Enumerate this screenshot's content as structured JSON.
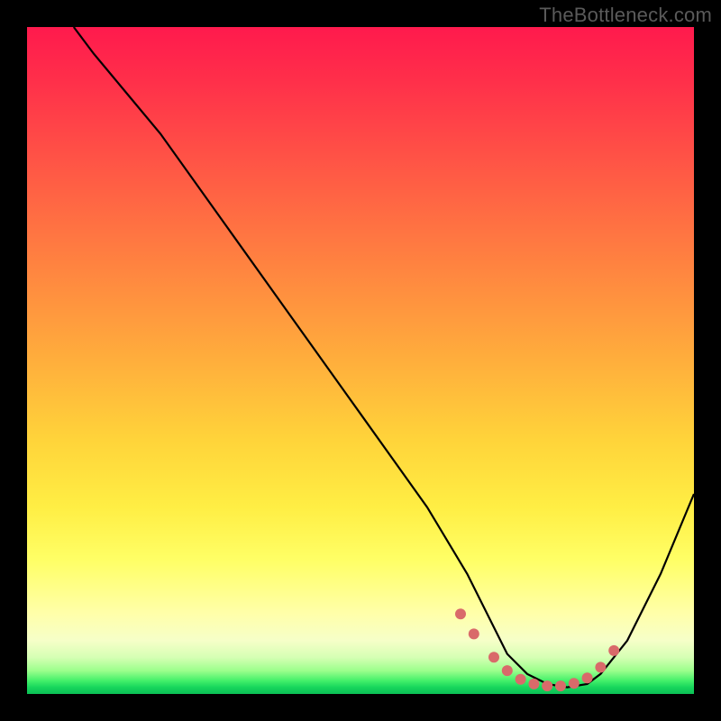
{
  "watermark": "TheBottleneck.com",
  "chart_data": {
    "type": "line",
    "title": "",
    "xlabel": "",
    "ylabel": "",
    "xlim": [
      0,
      100
    ],
    "ylim": [
      0,
      100
    ],
    "grid": false,
    "legend": false,
    "series": [
      {
        "name": "bottleneck-curve",
        "x": [
          7,
          10,
          15,
          20,
          30,
          40,
          50,
          60,
          66,
          70,
          72,
          75,
          78,
          81,
          84,
          86,
          90,
          95,
          100
        ],
        "y": [
          100,
          96,
          90,
          84,
          70,
          56,
          42,
          28,
          18,
          10,
          6,
          3,
          1.5,
          1,
          1.5,
          3,
          8,
          18,
          30
        ]
      }
    ],
    "annotations": [
      {
        "name": "valley-marker-dots",
        "type": "points",
        "color": "#d96a6a",
        "x": [
          65,
          67,
          70,
          72,
          74,
          76,
          78,
          80,
          82,
          84,
          86,
          88
        ],
        "y": [
          12,
          9,
          5.5,
          3.5,
          2.2,
          1.5,
          1.2,
          1.2,
          1.6,
          2.4,
          4,
          6.5
        ]
      }
    ],
    "gradient_stops": [
      {
        "pos": 0.0,
        "color": "#ff1a4d"
      },
      {
        "pos": 0.22,
        "color": "#ff5a45"
      },
      {
        "pos": 0.5,
        "color": "#ffae3c"
      },
      {
        "pos": 0.72,
        "color": "#ffee44"
      },
      {
        "pos": 0.88,
        "color": "#ffffaa"
      },
      {
        "pos": 0.96,
        "color": "#9cff8c"
      },
      {
        "pos": 1.0,
        "color": "#0bbf56"
      }
    ]
  }
}
